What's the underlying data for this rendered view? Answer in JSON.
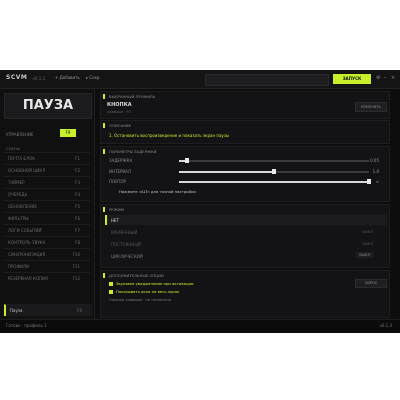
{
  "topbar": {
    "logo": "SCVM",
    "logo_sub": "· v0.1.3",
    "btn_add": "+ Добавить",
    "btn_save": "▸ Сохр.",
    "play_label": "ЗАПУСК",
    "icons": [
      "gear-icon",
      "minimize-icon",
      "close-icon"
    ]
  },
  "left": {
    "pause_title": "ПАУЗА",
    "ctl_label": "УПРАВЛЕНИЕ",
    "ctl_button": "F9",
    "section_title": "СЦЕНЫ",
    "rows": [
      {
        "name": "ПОЧТА БЛОК",
        "val": "F1"
      },
      {
        "name": "ОСНОВНОЙ ЦИКЛ",
        "val": "F2"
      },
      {
        "name": "ТАЙМЕР",
        "val": "F3"
      },
      {
        "name": "ОЧЕРЕДЬ",
        "val": "F4"
      },
      {
        "name": "ОБНОВЛЕНИЕ",
        "val": "F5"
      },
      {
        "name": "ФИЛЬТРЫ",
        "val": "F6"
      },
      {
        "name": "ЛОГИ СОБЫТИЙ",
        "val": "F7"
      },
      {
        "name": "КОНТРОЛЬ ЗВУКА",
        "val": "F8"
      },
      {
        "name": "СИНХРОНИЗАЦИЯ",
        "val": "F10"
      },
      {
        "name": "ПРОФИЛИ",
        "val": "F11"
      },
      {
        "name": "РЕЗЕРВНАЯ КОПИЯ",
        "val": "F12"
      },
      {
        "name": "Пауза",
        "val": "F9",
        "active": true
      }
    ]
  },
  "main": {
    "p1_title": "ВЫБРАННЫЙ ПРОФИЛЬ",
    "p1_name": "КНОПКА",
    "p1_sub": "клавиша · F9",
    "p1_btn": "ИЗМЕНИТЬ",
    "p2_title": "ОПИСАНИЕ",
    "p2_text": "1. Остановить воспроизведение и показать экран паузы",
    "p3_title": "ПАРАМЕТРЫ ЗАДЕРЖКИ",
    "sliders": [
      {
        "label": "ЗАДЕРЖКА",
        "val": "0.05",
        "fraction": 0.04
      },
      {
        "label": "ИНТЕРВАЛ",
        "val": "1.0",
        "fraction": 0.5
      },
      {
        "label": "ПОВТОР",
        "val": "∞",
        "fraction": 1.0
      }
    ],
    "p3_note": "Нажмите «ALT» для точной настройки",
    "p4_title": "РЕЖИМ",
    "modes": [
      {
        "label": "НЕТ",
        "val": ""
      },
      {
        "label": "ВРЕМЕННЫЙ",
        "val": "ВЫКЛ"
      },
      {
        "label": "ПОСТОЯННЫЙ",
        "val": "ВЫКЛ"
      },
      {
        "label": "ЦИКЛИЧЕСКИЙ",
        "val": "ВЫКЛ"
      }
    ],
    "p5_title": "ДОПОЛНИТЕЛЬНЫЕ ОПЦИИ",
    "p5_btn": "СБРОС",
    "options": [
      "Звуковое уведомление при активации",
      "Показывать окно на весь экран"
    ],
    "p5_note": "Горячая клавиша · не назначена"
  },
  "status": {
    "left": "Готово · профиль 1",
    "right": "v0.1.3"
  },
  "colors": {
    "accent": "#c7f02b",
    "bg": "#0d0d0e"
  }
}
